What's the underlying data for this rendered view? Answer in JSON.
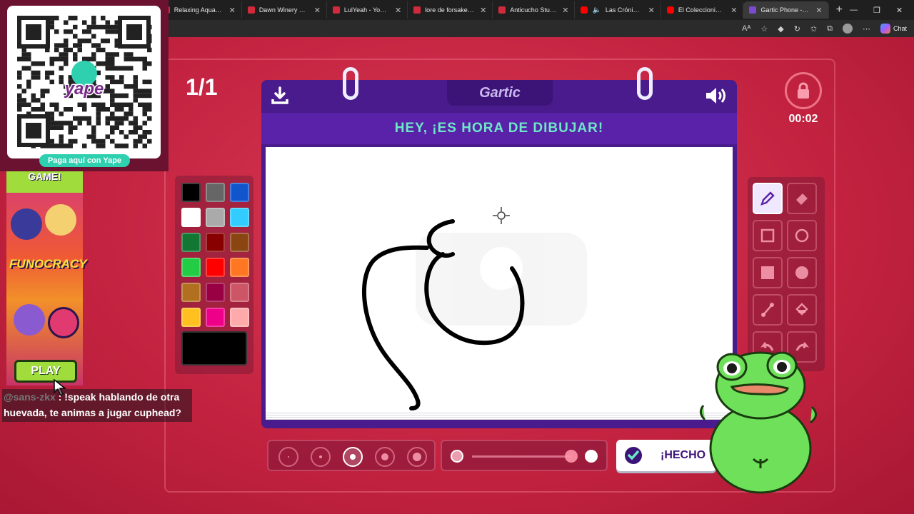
{
  "browser": {
    "tabs": [
      {
        "title": "Relaxing Aquatic Am",
        "favicon": "youtube"
      },
      {
        "title": "Dawn Winery Theme",
        "favicon": "youtube"
      },
      {
        "title": "LulYeah - YouTube",
        "favicon": "youtube"
      },
      {
        "title": "lore de forsaken - Yo",
        "favicon": "youtube"
      },
      {
        "title": "Anticucho Studios -",
        "favicon": "youtube"
      },
      {
        "title": "Las Crónicas de",
        "favicon": "youtube"
      },
      {
        "title": "El Coleccionista De",
        "favicon": "youtube"
      },
      {
        "title": "Gartic Phone - Teléfo",
        "favicon": "gartic",
        "active": true
      }
    ],
    "chat_label": "Chat"
  },
  "game": {
    "round": "1/1",
    "timer": "00:02",
    "brand": "Gartic",
    "header_text": "HEY, ¡ES HORA DE DIBUJAR!",
    "done_label": "¡HECHO",
    "palette": [
      "#000000",
      "#666666",
      "#1155cc",
      "#ffffff",
      "#aaaaaa",
      "#33ccff",
      "#117733",
      "#880000",
      "#8b4513",
      "#22cc44",
      "#ff0000",
      "#ff7722",
      "#b07020",
      "#990044",
      "#cc5566",
      "#ffc020",
      "#ee0088",
      "#ffaaaa"
    ],
    "current_color": "#000000",
    "tools": [
      "pencil-icon",
      "eraser-icon",
      "square-outline-icon",
      "circle-outline-icon",
      "square-fill-icon",
      "circle-fill-icon",
      "line-icon",
      "bucket-icon",
      "undo-icon",
      "redo-icon"
    ],
    "active_tool": "pencil-icon",
    "brush_sizes": 5,
    "active_size": 3
  },
  "overlays": {
    "qr_caption": "Paga aquí con Yape",
    "qr_brand": "yape",
    "ad_title": "GAME!",
    "ad_logo": "FUNOCRACY",
    "play_label": "PLAY",
    "chat_user": "@sans-zkx",
    "chat_text": " : !speak hablando de otra huevada, te animas a jugar cuphead?"
  }
}
